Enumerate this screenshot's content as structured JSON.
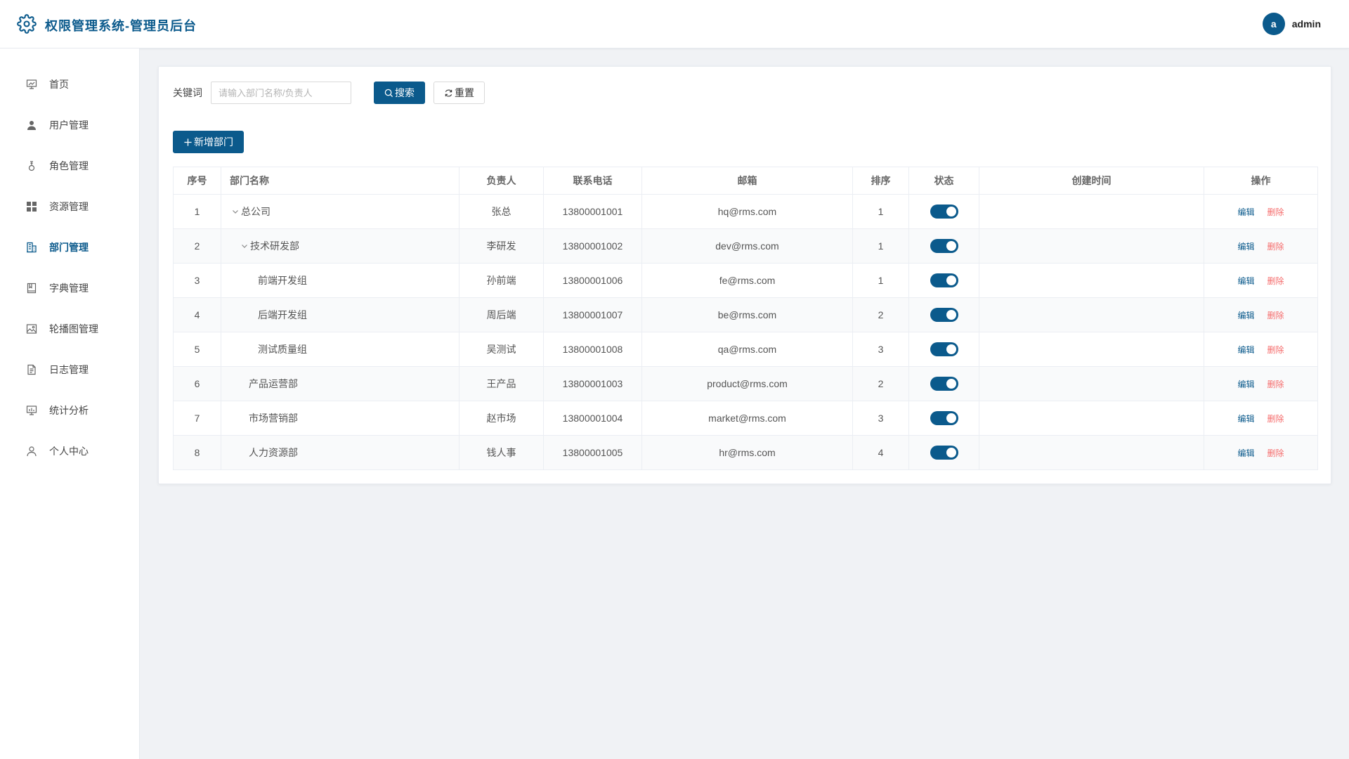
{
  "header": {
    "title": "权限管理系统-管理员后台",
    "avatar_letter": "a",
    "username": "admin"
  },
  "sidebar": {
    "items": [
      {
        "label": "首页",
        "icon": "dashboard-icon",
        "active": false
      },
      {
        "label": "用户管理",
        "icon": "user-icon",
        "active": false
      },
      {
        "label": "角色管理",
        "icon": "role-icon",
        "active": false
      },
      {
        "label": "资源管理",
        "icon": "grid-icon",
        "active": false
      },
      {
        "label": "部门管理",
        "icon": "building-icon",
        "active": true
      },
      {
        "label": "字典管理",
        "icon": "book-icon",
        "active": false
      },
      {
        "label": "轮播图管理",
        "icon": "image-icon",
        "active": false
      },
      {
        "label": "日志管理",
        "icon": "document-icon",
        "active": false
      },
      {
        "label": "统计分析",
        "icon": "chart-icon",
        "active": false
      },
      {
        "label": "个人中心",
        "icon": "person-icon",
        "active": false
      }
    ]
  },
  "search": {
    "label": "关键词",
    "placeholder": "请输入部门名称/负责人",
    "value": "",
    "search_button": "搜索",
    "reset_button": "重置"
  },
  "toolbar": {
    "add_button": "新增部门"
  },
  "table": {
    "headers": [
      "序号",
      "部门名称",
      "负责人",
      "联系电话",
      "邮箱",
      "排序",
      "状态",
      "创建时间",
      "操作"
    ],
    "edit_label": "编辑",
    "delete_label": "删除",
    "rows": [
      {
        "index": "1",
        "name": "总公司",
        "level": 0,
        "expanded": true,
        "leader": "张总",
        "phone": "13800001001",
        "email": "hq@rms.com",
        "sort": "1",
        "enabled": true,
        "created": ""
      },
      {
        "index": "2",
        "name": "技术研发部",
        "level": 1,
        "expanded": true,
        "leader": "李研发",
        "phone": "13800001002",
        "email": "dev@rms.com",
        "sort": "1",
        "enabled": true,
        "created": ""
      },
      {
        "index": "3",
        "name": "前端开发组",
        "level": 2,
        "expanded": null,
        "leader": "孙前端",
        "phone": "13800001006",
        "email": "fe@rms.com",
        "sort": "1",
        "enabled": true,
        "created": ""
      },
      {
        "index": "4",
        "name": "后端开发组",
        "level": 2,
        "expanded": null,
        "leader": "周后端",
        "phone": "13800001007",
        "email": "be@rms.com",
        "sort": "2",
        "enabled": true,
        "created": ""
      },
      {
        "index": "5",
        "name": "测试质量组",
        "level": 2,
        "expanded": null,
        "leader": "吴测试",
        "phone": "13800001008",
        "email": "qa@rms.com",
        "sort": "3",
        "enabled": true,
        "created": ""
      },
      {
        "index": "6",
        "name": "产品运营部",
        "level": 1,
        "expanded": null,
        "leader": "王产品",
        "phone": "13800001003",
        "email": "product@rms.com",
        "sort": "2",
        "enabled": true,
        "created": ""
      },
      {
        "index": "7",
        "name": "市场营销部",
        "level": 1,
        "expanded": null,
        "leader": "赵市场",
        "phone": "13800001004",
        "email": "market@rms.com",
        "sort": "3",
        "enabled": true,
        "created": ""
      },
      {
        "index": "8",
        "name": "人力资源部",
        "level": 1,
        "expanded": null,
        "leader": "钱人事",
        "phone": "13800001005",
        "email": "hr@rms.com",
        "sort": "4",
        "enabled": true,
        "created": ""
      }
    ]
  },
  "colors": {
    "primary": "#0b5a8c",
    "danger": "#f56c6c"
  }
}
